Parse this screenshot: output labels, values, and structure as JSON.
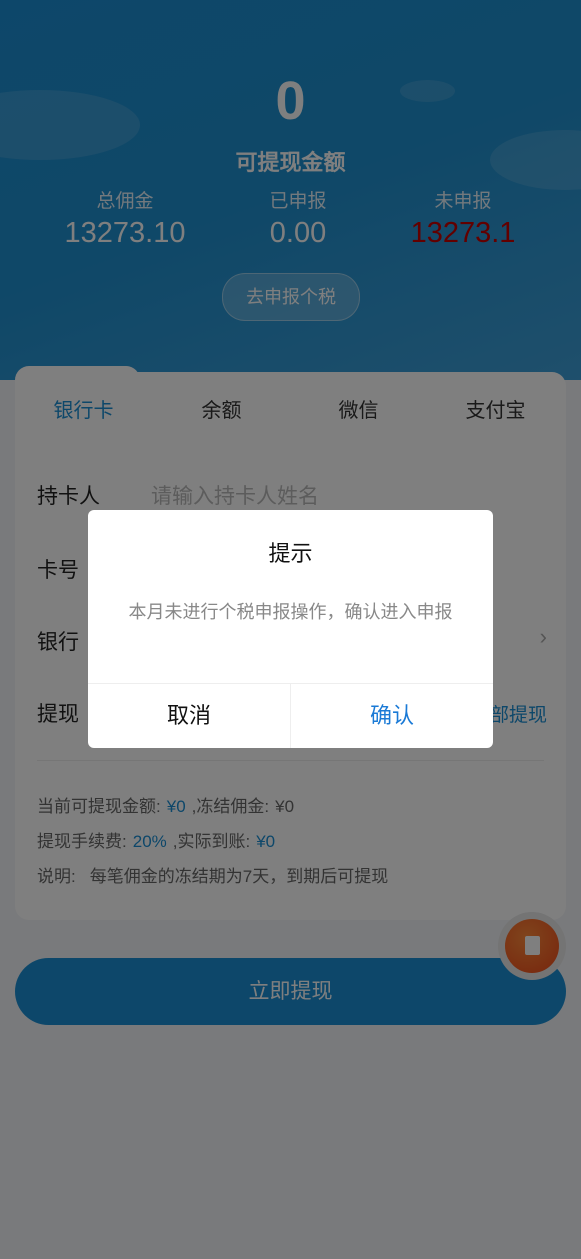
{
  "header": {
    "withdrawable_amount": "0",
    "withdrawable_label": "可提现金额",
    "stats": [
      {
        "label": "总佣金",
        "value": "13273.10"
      },
      {
        "label": "已申报",
        "value": "0.00"
      },
      {
        "label": "未申报",
        "value": "13273.1"
      }
    ],
    "declare_button": "去申报个税"
  },
  "tabs": [
    {
      "label": "银行卡"
    },
    {
      "label": "余额"
    },
    {
      "label": "微信"
    },
    {
      "label": "支付宝"
    }
  ],
  "form": {
    "cardholder_label": "持卡人",
    "cardholder_placeholder": "请输入持卡人姓名",
    "card_number_label": "卡号",
    "bank_label": "银行",
    "withdraw_label": "提现",
    "withdraw_all_label": "全部提现"
  },
  "info": {
    "current_label": "当前可提现金额:",
    "current_value": "¥0",
    "frozen_label": ",冻结佣金:",
    "frozen_value": "¥0",
    "fee_label": "提现手续费:",
    "fee_value": "20%",
    "actual_label": ",实际到账:",
    "actual_value": "¥0",
    "note_label": "说明:",
    "note_text": "每笔佣金的冻结期为7天，到期后可提现"
  },
  "submit_button": "立即提现",
  "dialog": {
    "title": "提示",
    "message": "本月未进行个税申报操作，确认进入申报",
    "cancel": "取消",
    "confirm": "确认"
  },
  "colors": {
    "primary": "#1b8fd4",
    "danger": "#c40000",
    "confirm": "#1a7ad6"
  },
  "icons": {
    "chevron": "chevron-right-icon",
    "fab": "paper-icon"
  }
}
